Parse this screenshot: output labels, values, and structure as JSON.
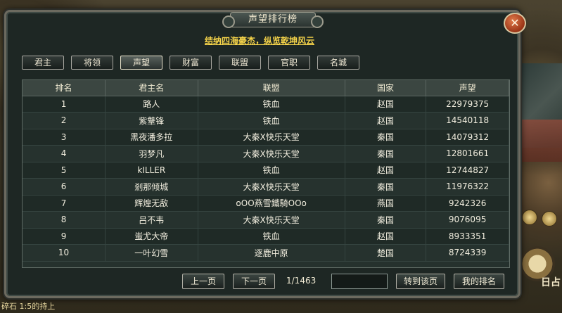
{
  "window": {
    "title": "声望排行榜",
    "slogan": "结纳四海豪杰，纵览乾坤风云",
    "close_symbol": "✕"
  },
  "tabs": [
    {
      "label": "君主",
      "active": false
    },
    {
      "label": "将领",
      "active": false
    },
    {
      "label": "声望",
      "active": true
    },
    {
      "label": "财富",
      "active": false
    },
    {
      "label": "联盟",
      "active": false
    },
    {
      "label": "官职",
      "active": false
    },
    {
      "label": "名城",
      "active": false
    }
  ],
  "table": {
    "headers": [
      "排名",
      "君主名",
      "联盟",
      "国家",
      "声望"
    ],
    "rows": [
      [
        "1",
        "路人",
        "铁血",
        "赵国",
        "22979375"
      ],
      [
        "2",
        "紫鞶锋",
        "铁血",
        "赵国",
        "14540118"
      ],
      [
        "3",
        "黑夜潘多拉",
        "大秦X快乐天堂",
        "秦国",
        "14079312"
      ],
      [
        "4",
        "羽梦凡",
        "大秦X快乐天堂",
        "秦国",
        "12801661"
      ],
      [
        "5",
        "kILLER",
        "铁血",
        "赵国",
        "12744827"
      ],
      [
        "6",
        "剎那倾城",
        "大秦X快乐天堂",
        "秦国",
        "11976322"
      ],
      [
        "7",
        "辉煌无敌",
        "oOO燕雪鐵騎OOo",
        "燕国",
        "9242326"
      ],
      [
        "8",
        "吕不韦",
        "大秦X快乐天堂",
        "秦国",
        "9076095"
      ],
      [
        "9",
        "蚩尤大帝",
        "铁血",
        "赵国",
        "8933351"
      ],
      [
        "10",
        "一叶幻雪",
        "逐鹿中原",
        "楚国",
        "8724339"
      ]
    ]
  },
  "pager": {
    "prev_label": "上一页",
    "next_label": "下一页",
    "page_info": "1/1463",
    "page_input_value": "",
    "goto_label": "转到该页",
    "my_rank_label": "我的排名"
  },
  "background": {
    "bottom_text": "碎石 1:5的持上",
    "side_char": "日占"
  },
  "colors": {
    "slogan": "#f6d44a",
    "frame_border": "#6c6a5f",
    "table_bg": "#25312d",
    "close_button": "#c0502a"
  },
  "icons": [
    "close-icon",
    "bagua-icon",
    "coin-icon"
  ]
}
